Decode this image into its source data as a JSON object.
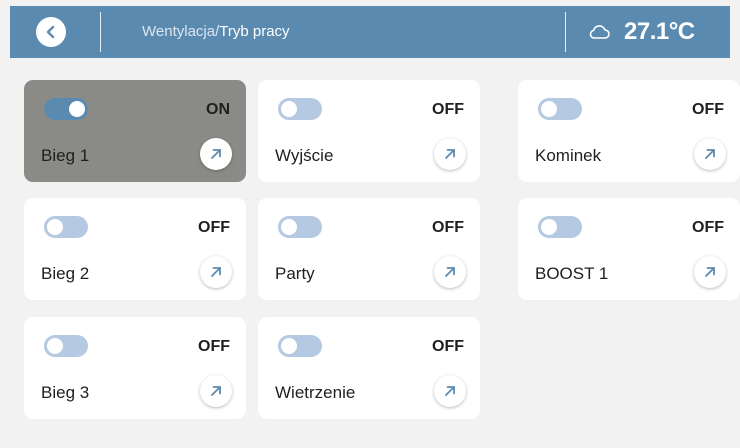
{
  "header": {
    "back_icon": "chevron-left-icon",
    "breadcrumb_parent": "Wentylacja/",
    "breadcrumb_current": "Tryb pracy",
    "weather_icon": "cloud-icon",
    "temperature": "27.1°C",
    "bar_color": "#5b8ab1"
  },
  "tiles": [
    {
      "label": "Bieg 1",
      "state": "ON",
      "on": true
    },
    {
      "label": "Wyjście",
      "state": "OFF",
      "on": false
    },
    {
      "label": "Kominek",
      "state": "OFF",
      "on": false
    },
    {
      "label": "Bieg 2",
      "state": "OFF",
      "on": false
    },
    {
      "label": "Party",
      "state": "OFF",
      "on": false
    },
    {
      "label": "BOOST 1",
      "state": "OFF",
      "on": false
    },
    {
      "label": "Bieg 3",
      "state": "OFF",
      "on": false
    },
    {
      "label": "Wietrzenie",
      "state": "OFF",
      "on": false
    }
  ],
  "colors": {
    "accent": "#5b8ab1",
    "toggle_off": "#b5c9e2",
    "active_tile": "#8a8a87",
    "background": "#f2f2f2"
  }
}
